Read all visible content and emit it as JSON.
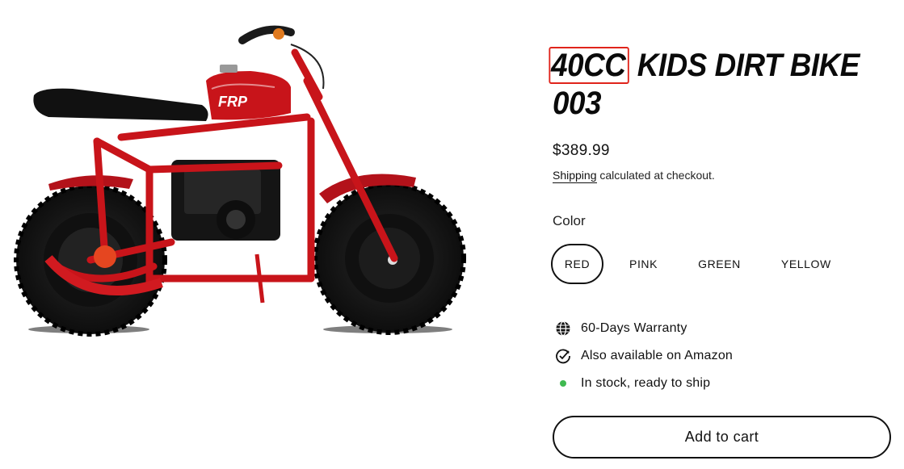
{
  "product": {
    "title_highlight": "40CC",
    "title_rest": " KIDS DIRT BIKE 003",
    "price": "$389.99",
    "shipping_link": "Shipping",
    "shipping_text": " calculated at checkout.",
    "color_label": "Color",
    "colors": [
      "RED",
      "PINK",
      "GREEN",
      "YELLOW"
    ],
    "selected_color": "RED",
    "features": [
      {
        "icon": "globe-icon",
        "text": "60-Days Warranty"
      },
      {
        "icon": "check-circle-icon",
        "text": "Also available on Amazon"
      },
      {
        "icon": "in-stock-dot-icon",
        "text": "In stock, ready to ship"
      }
    ],
    "add_to_cart": "Add to cart",
    "image_alt": "Red kids dirt bike",
    "logo_text": "FRP"
  },
  "colors": {
    "highlight_border": "#e0241b",
    "stock_dot": "#3fb950",
    "bike_red": "#c8141a",
    "tire_black": "#1a1a1a"
  }
}
